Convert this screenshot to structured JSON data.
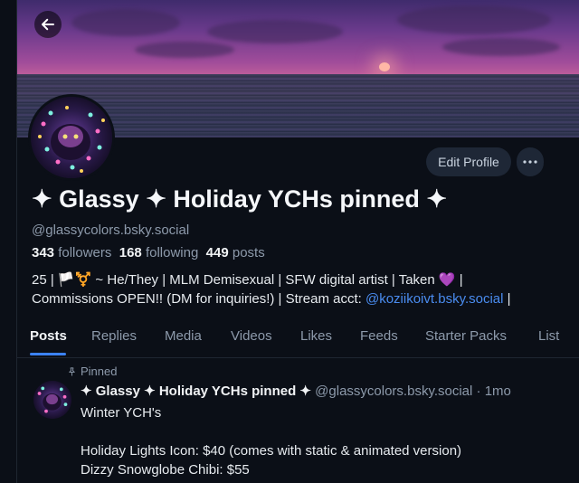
{
  "profile": {
    "display_name": "✦ Glassy ✦ Holiday YCHs pinned ✦",
    "handle": "@glassycolors.bsky.social",
    "followers_count": "343",
    "followers_label": "followers",
    "following_count": "168",
    "following_label": "following",
    "posts_count": "449",
    "posts_label": "posts",
    "bio_line1": "25 | 🏳️⚧️ ~ He/They | MLM Demisexual | SFW digital artist | Taken 💜 |",
    "bio_line2_prefix": "Commissions OPEN!! (DM for inquiries!) | Stream acct: ",
    "bio_line2_link": "@koziikoivt.bsky.social",
    "bio_line2_suffix": " |"
  },
  "actions": {
    "edit_profile_label": "Edit Profile",
    "more_label": "···"
  },
  "tabs": [
    {
      "label": "Posts",
      "active": true
    },
    {
      "label": "Replies"
    },
    {
      "label": "Media"
    },
    {
      "label": "Videos"
    },
    {
      "label": "Likes"
    },
    {
      "label": "Feeds"
    },
    {
      "label": "Starter Packs"
    },
    {
      "label": "List"
    }
  ],
  "post": {
    "pinned_label": "Pinned",
    "author_name": "✦ Glassy ✦ Holiday YCHs pinned ✦",
    "author_handle": "@glassycolors.bsky.social",
    "separator": "·",
    "time": "1mo",
    "text": "Winter YCH's\n\nHoliday Lights Icon: $40 (comes with static & animated version)\nDizzy Snowglobe Chibi: $55"
  },
  "colors": {
    "background": "#0b0f17",
    "accent": "#3b82f6",
    "link": "#4a8cf0",
    "muted_text": "#8d9aab"
  },
  "icons": {
    "back": "arrow-left-icon",
    "more": "ellipsis-icon",
    "pinned": "pin-icon"
  }
}
